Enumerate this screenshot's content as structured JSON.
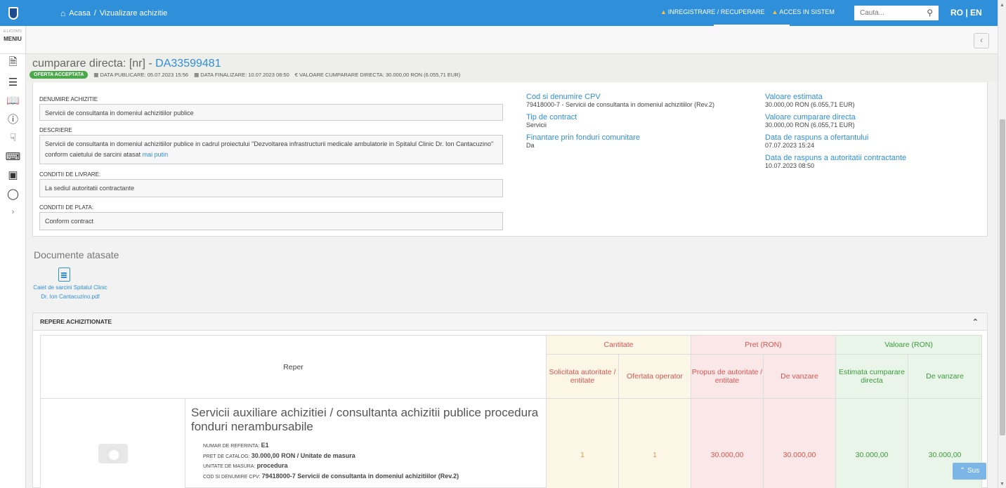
{
  "topbar": {
    "breadcrumb_home": "Acasa",
    "breadcrumb_sep": "/",
    "breadcrumb_current": "Vizualizare achizitie",
    "link_register": "INREGISTRARE / RECUPERARE",
    "link_login": "ACCES IN SISTEM",
    "search_placeholder": "Cauta...",
    "language": "RO | EN",
    "accent_color": "#2f8fd8"
  },
  "sidebar": {
    "brand_small": "E-LICITATII",
    "menu_label": "MENIU",
    "icons": [
      "document-icon",
      "list-edit-icon",
      "book-icon",
      "help-icon",
      "touch-icon",
      "keyboard-icon",
      "monitor-icon",
      "chat-icon",
      "chevron-right-icon"
    ]
  },
  "procurement": {
    "title_prefix": "cumparare directa: [nr] - ",
    "code": "DA33599481",
    "status_badge": "OFERTA ACCEPTATA",
    "status_color": "#4ba84b",
    "publish_date": "DATA PUBLICARE: 05.07.2023 15:56",
    "end_date": "DATA FINALIZARE: 10.07.2023 08:50",
    "value": "VALOARE CUMPARARE DIRECTA: 30.000,00  RON (6.055,71  EUR)"
  },
  "details": {
    "name_label": "DENUMIRE ACHIZITIE",
    "name_value": "Servicii de consultanta in domeniul achizitiilor publice",
    "desc_label": "DESCRIERE",
    "desc_value": "Servicii de consultanta in domeniul achizitiilor publice in cadrul proiectului \"Dezvoltarea infrastructurii medicale ambulatorie in Spitalul Clinic Dr. Ion Cantacuzino\" conform caietului de sarcini atasat",
    "desc_more": "mai putin",
    "delivery_label": "CONDITII DE LIVRARE:",
    "delivery_value": "La sediul autoritatii contractante",
    "payment_label": "CONDITII DE PLATA:",
    "payment_value": "Conform contract",
    "cpv_label": "Cod si denumire CPV",
    "cpv_value": "79418000-7 - Servicii de consultanta in domeniul achizitiilor (Rev.2)",
    "contract_type_label": "Tip de contract",
    "contract_type_value": "Servicii",
    "eu_funds_label": "Finantare prin fonduri comunitare",
    "eu_funds_value": "Da",
    "estimated_label": "Valoare estimata",
    "estimated_value": "30.000,00  RON (6.055,71  EUR)",
    "direct_value_label": "Valoare cumparare directa",
    "direct_value_value": "30.000,00  RON (6.055,71  EUR)",
    "bidder_reply_label": "Data de raspuns a ofertantului",
    "bidder_reply_value": "07.07.2023 15:24",
    "authority_reply_label": "Data de raspuns a autoritatii contractante",
    "authority_reply_value": "10.07.2023 08:50"
  },
  "documents": {
    "title": "Documente atasate",
    "file_name": "Caiet de sarcini Spitalul Clinic Dr. Ion Cantacuzino.pdf"
  },
  "items_panel": {
    "title": "REPERE ACHIZITIONATE",
    "headers": {
      "reper": "Reper",
      "quantity": "Cantitate",
      "price": "Pret (RON)",
      "value": "Valoare (RON)",
      "qty_requested": "Solicitata autoritate / entitate",
      "qty_offered": "Ofertata operator",
      "price_proposed": "Propus de autoritate / entitate",
      "price_sale": "De vanzare",
      "value_estimated": "Estimata cumparare directa",
      "value_sale": "De vanzare"
    },
    "rows": [
      {
        "title": "Servicii auxiliare achizitiei / consultanta achizitii publice procedura fonduri nerambursabile",
        "ref_label": "NUMAR DE REFERINTA:",
        "ref_value": "E1",
        "catalog_label": "PRET DE CATALOG:",
        "catalog_value": "30.000,00  RON / Unitate de masura",
        "unit_label": "UNITATE DE MASURA:",
        "unit_value": "procedura",
        "cpv_label": "COD SI DENUMIRE CPV:",
        "cpv_value": "79418000-7 Servicii de consultanta in domeniul achizitiilor (Rev.2)",
        "qty_requested": "1",
        "qty_offered": "1",
        "price_proposed": "30.000,00",
        "price_sale": "30.000,00",
        "value_estimated": "30.000,00",
        "value_sale": "30.000,00"
      }
    ]
  },
  "back_to_top": "Sus"
}
